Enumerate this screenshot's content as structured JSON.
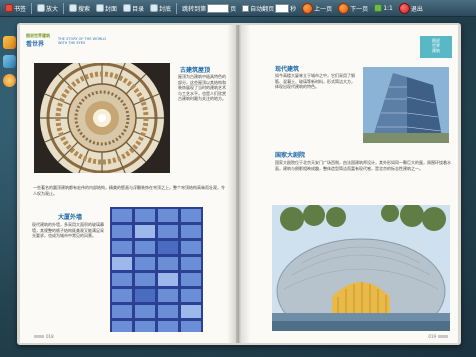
{
  "toolbar": {
    "items": [
      {
        "label": "书签"
      },
      {
        "label": "放大"
      },
      {
        "label": "搜索"
      },
      {
        "label": "封面"
      },
      {
        "label": "目录"
      },
      {
        "label": "封底"
      }
    ],
    "goto_label": "跳转到第",
    "goto_value": "",
    "page_unit": "页",
    "auto_flip_label": "自动翻页",
    "seconds_value": "",
    "seconds_unit": "秒",
    "prev_label": "上一页",
    "next_label": "下一页",
    "ratio_label": "1:1",
    "exit_label": "退出"
  },
  "left_page": {
    "logo_line1": "图说世界建筑",
    "logo_line2": "看世界",
    "logo_line3": "THE STORY OF THE WORLD WITH THE EYES",
    "section1_title": "古建筑屋顶",
    "section1_text": "屋顶为古建筑中极具特色的部分，这些屋顶以其结构和装饰展现了当时的建筑艺术与工艺水平，也是人们欣赏古建筑时最为关注的地方。",
    "section1_cont": "一些著名的圆顶建筑都有宏伟的内部结构，精美的壁画与浮雕装饰在穹顶之上，整个穹顶结构高耸而壮观，令人叹为观止。",
    "section2_title": "大厦外墙",
    "section2_text": "现代建筑的外墙，多采用大面积的玻璃幕墙，其规整的格子结构既美观又能满足采光要求，也成为城市中常见的风景。",
    "page_number": "018"
  },
  "right_page": {
    "tag_line1": "图说",
    "tag_line2": "世界",
    "tag_line3": "建筑",
    "section1_title": "现代建筑",
    "section1_text": "如今高楼大厦林立于城市之中，它们采用了钢筋、混凝土、玻璃等新材料，形式简洁大方，体现出现代建筑的特色。",
    "section2_title": "国家大剧院",
    "section2_text": "国家大剧院位于北京天安门广场西侧，由法国建筑师设计，其外形如同一颗巨大的蛋，周围环绕着水面，建筑与倒影相映成趣，整体造型简洁而富有现代感，是北京的标志性建筑之一。",
    "page_number": "019"
  }
}
